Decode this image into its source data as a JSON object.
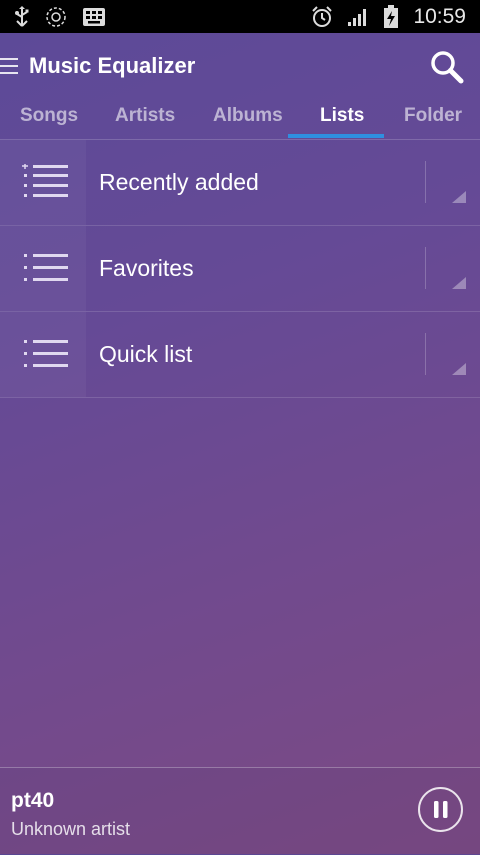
{
  "status_bar": {
    "time": "10:59",
    "left_icons": [
      "usb-icon",
      "sync-icon",
      "keyboard-icon"
    ],
    "right_icons": [
      "alarm-icon",
      "signal-icon",
      "battery-charging-icon"
    ]
  },
  "app_bar": {
    "title": "Music Equalizer",
    "menu_icon": "hamburger-icon",
    "search_icon": "search-icon"
  },
  "tabs": [
    {
      "label": "Songs",
      "active": false
    },
    {
      "label": "Artists",
      "active": false
    },
    {
      "label": "Albums",
      "active": false
    },
    {
      "label": "Lists",
      "active": true
    },
    {
      "label": "Folder",
      "active": false
    }
  ],
  "lists": [
    {
      "label": "Recently added",
      "icon": "playlist-add-icon"
    },
    {
      "label": "Favorites",
      "icon": "playlist-icon"
    },
    {
      "label": "Quick list",
      "icon": "playlist-icon"
    }
  ],
  "now_playing": {
    "title": "pt40",
    "artist": "Unknown artist",
    "control_icon": "pause-icon"
  },
  "colors": {
    "tab_indicator": "#2f8fe0",
    "background_top": "#5c4a98",
    "background_bottom": "#7c4a83"
  }
}
